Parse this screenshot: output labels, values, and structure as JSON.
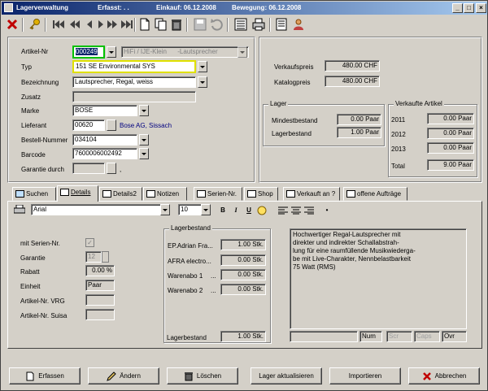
{
  "titlebar": {
    "title": "Lagerverwaltung",
    "erfasst": "Erfasst: . .",
    "einkauf": "Einkauf: 06.12.2008",
    "bewegung": "Bewegung: 06.12.2008",
    "btn_min": "_",
    "btn_max": "□",
    "btn_close": "×"
  },
  "toolbar": {
    "icons": [
      "close-icon",
      "key-icon",
      "first-record-icon",
      "prev-page-icon",
      "prev-record-icon",
      "next-record-icon",
      "next-page-icon",
      "last-record-icon",
      "new-document-icon",
      "copy-icon",
      "delete-icon",
      "save-icon",
      "undo-icon",
      "list-icon",
      "print-icon",
      "notes-icon",
      "search-person-icon"
    ]
  },
  "form": {
    "artikel_nr_label": "Artikel-Nr",
    "artikel_nr_value": "000249",
    "artikel_nr_extra": "HiFi / IJE-Klein",
    "artikel_nr_extra2": "-Lautsprecher",
    "typ_label": "Typ",
    "typ_value": "151 SE Environmental SYS",
    "bezeichnung_label": "Bezeichnung",
    "bezeichnung_value": "Lautsprecher, Regal, weiss",
    "zusatz_label": "Zusatz",
    "zusatz_value": "",
    "marke_label": "Marke",
    "marke_value": "BOSE",
    "lieferant_label": "Lieferant",
    "lieferant_value": "00620",
    "lieferant_name": "Bose AG, Sissach",
    "bestell_label": "Bestell-Nummer",
    "bestell_value": "034104",
    "barcode_label": "Barcode",
    "barcode_value": "7600006002492",
    "garantie_label": "Garantie durch",
    "garantie_suffix": ","
  },
  "prices": {
    "verkaufspreis_label": "Verkaufspreis",
    "verkaufspreis_value": "480.00 CHF",
    "katalogpreis_label": "Katalogpreis",
    "katalogpreis_value": "480.00 CHF"
  },
  "lager": {
    "legend": "Lager",
    "mindest_label": "Mindestbestand",
    "mindest_value": "0.00 Paar",
    "bestand_label": "Lagerbestand",
    "bestand_value": "1.00 Paar"
  },
  "verkauft": {
    "legend": "Verkaufte Artikel",
    "rows": [
      {
        "label": "2011",
        "value": "0.00 Paar"
      },
      {
        "label": "2012",
        "value": "0.00 Paar"
      },
      {
        "label": "2013",
        "value": "0.00 Paar"
      },
      {
        "label": "Total",
        "value": "9.00 Paar"
      }
    ]
  },
  "tabs": [
    {
      "label": "Suchen",
      "underline": "S"
    },
    {
      "label": "Details",
      "underline": "D"
    },
    {
      "label": "Details2",
      "underline": ""
    },
    {
      "label": "Notizen",
      "underline": "N"
    },
    {
      "label": "Serien-Nr.",
      "underline": ""
    },
    {
      "label": "Shop",
      "underline": ""
    },
    {
      "label": "Verkauft an ?",
      "underline": ""
    },
    {
      "label": "offene Aufträge",
      "underline": ""
    }
  ],
  "formatbar": {
    "font": "Arial",
    "size": "10",
    "bold": "B",
    "italic": "I",
    "underline": "U",
    "bullet": "•"
  },
  "details": {
    "serien_label": "mit Serien-Nr.",
    "garantie_label": "Garantie",
    "garantie_value": "12",
    "rabatt_label": "Rabatt",
    "rabatt_value": "0.00 %",
    "einheit_label": "Einheit",
    "einheit_value": "Paar",
    "vrg_label": "Artikel-Nr. VRG",
    "suisa_label": "Artikel-Nr. Suisa"
  },
  "lagerbestand": {
    "legend": "Lagerbestand",
    "rows": [
      {
        "label": "EP.Adrian Fra...",
        "value": "1.00 Stk."
      },
      {
        "label": "AFRA electro...",
        "value": "0.00 Stk."
      },
      {
        "label": "Warenabo 1",
        "dots": "...",
        "value": "0.00 Stk."
      },
      {
        "label": "Warenabo 2",
        "dots": "...",
        "value": "0.00 Stk."
      }
    ],
    "total_label": "Lagerbestand",
    "total_value": "1.00 Stk."
  },
  "notes": {
    "line1": "Hochwertiger Regal-Lautsprecher mit",
    "line2": "direkter und indirekter Schallabstrah-",
    "line3": "lung für eine raumfüllende Musikwiederga-",
    "line4": "be mit Live-Charakter, Nennbelastbarkeit",
    "line5": "75 Watt (RMS)"
  },
  "statusbar": {
    "num": "Num",
    "scr": "Scr",
    "caps": "Caps",
    "ovr": "Ovr"
  },
  "buttons": {
    "erfassen": "Erfassen",
    "aendern": "Ändern",
    "loeschen": "Löschen",
    "lager_aktualisieren": "Lager aktualisieren",
    "importieren": "Importieren",
    "abbrechen": "Abbrechen"
  }
}
